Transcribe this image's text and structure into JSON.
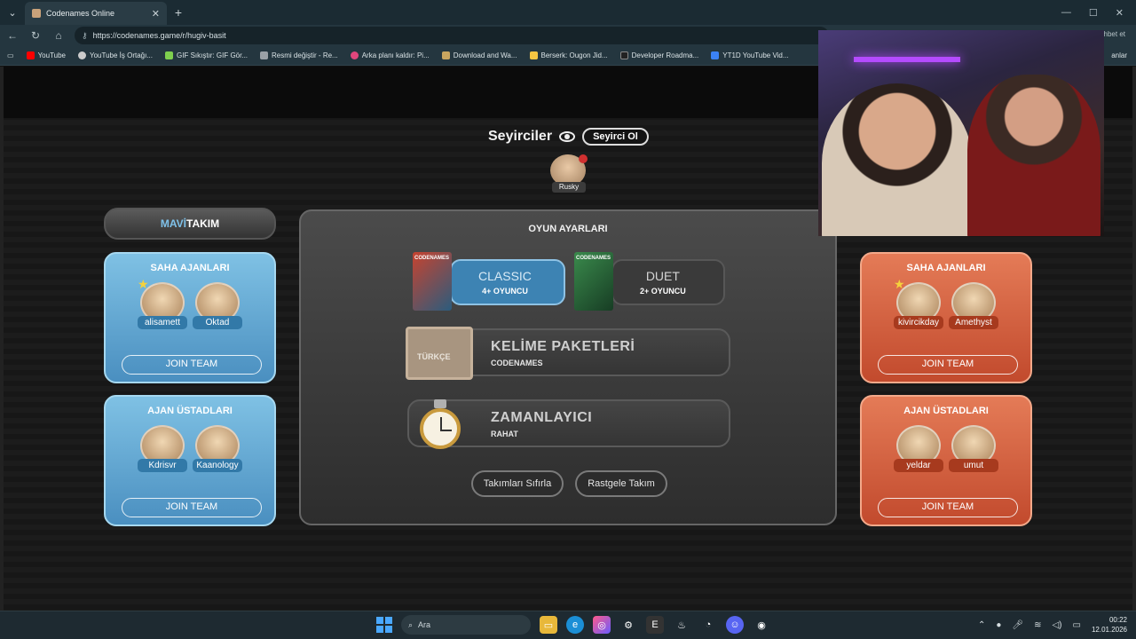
{
  "browser": {
    "tab_title": "Codenames Online",
    "url": "https://codenames.game/r/hugiv-basit",
    "addr_right": "hbet et",
    "bookmarks": [
      {
        "label": "YouTube",
        "color": "#ff0000"
      },
      {
        "label": "YouTube İş Ortağı...",
        "color": "#cccccc"
      },
      {
        "label": "GIF Sıkıştır: GIF Gör...",
        "color": "#7ecf4e"
      },
      {
        "label": "Resmi değiştir - Re...",
        "color": "#9aa0a6"
      },
      {
        "label": "Arka planı kaldır: Pi...",
        "color": "#e0467c"
      },
      {
        "label": "Download and Wa...",
        "color": "#c8a55f"
      },
      {
        "label": "Berserk: Ougon Jid...",
        "color": "#f5c542"
      },
      {
        "label": "Developer Roadma...",
        "color": "#222222"
      },
      {
        "label": "YT1D YouTube Vid...",
        "color": "#3b82f6"
      }
    ],
    "bookmarks_right": "anlar"
  },
  "spectators": {
    "title": "Seyirciler",
    "watch_button": "Seyirci Ol",
    "players": [
      "Rusky"
    ]
  },
  "blue_team": {
    "label_accent": "MAVİ",
    "label_rest": " TAKIM",
    "field_agents": {
      "title": "SAHA AJANLARI",
      "players": [
        "alisamett",
        "Oktad"
      ],
      "join": "JOIN TEAM"
    },
    "spymasters": {
      "title": "AJAN ÜSTADLARI",
      "players": [
        "Kdrisvr",
        "Kaanology"
      ],
      "join": "JOIN TEAM"
    }
  },
  "red_team": {
    "field_agents": {
      "title": "SAHA AJANLARI",
      "players": [
        "kivircikday",
        "Amethyst"
      ],
      "join": "JOIN TEAM"
    },
    "spymasters": {
      "title": "AJAN ÜSTADLARI",
      "players": [
        "yeldar",
        "umut"
      ],
      "join": "JOIN TEAM"
    }
  },
  "settings": {
    "title": "OYUN AYARLARI",
    "modes": [
      {
        "name": "CLASSIC",
        "sub": "4+ OYUNCU",
        "box": "CODENAMES"
      },
      {
        "name": "DUET",
        "sub": "2+ OYUNCU",
        "box": "CODENAMES"
      }
    ],
    "word_packs": {
      "name": "KELİME PAKETLERİ",
      "sub": "CODENAMES",
      "badge": "TÜRKÇE"
    },
    "timer": {
      "name": "ZAMANLAYICI",
      "sub": "RAHAT"
    },
    "reset_button": "Takımları Sıfırla",
    "random_button": "Rastgele Takım"
  },
  "taskbar": {
    "search_placeholder": "Ara",
    "time": "00:22",
    "date": "12.01.2026"
  }
}
